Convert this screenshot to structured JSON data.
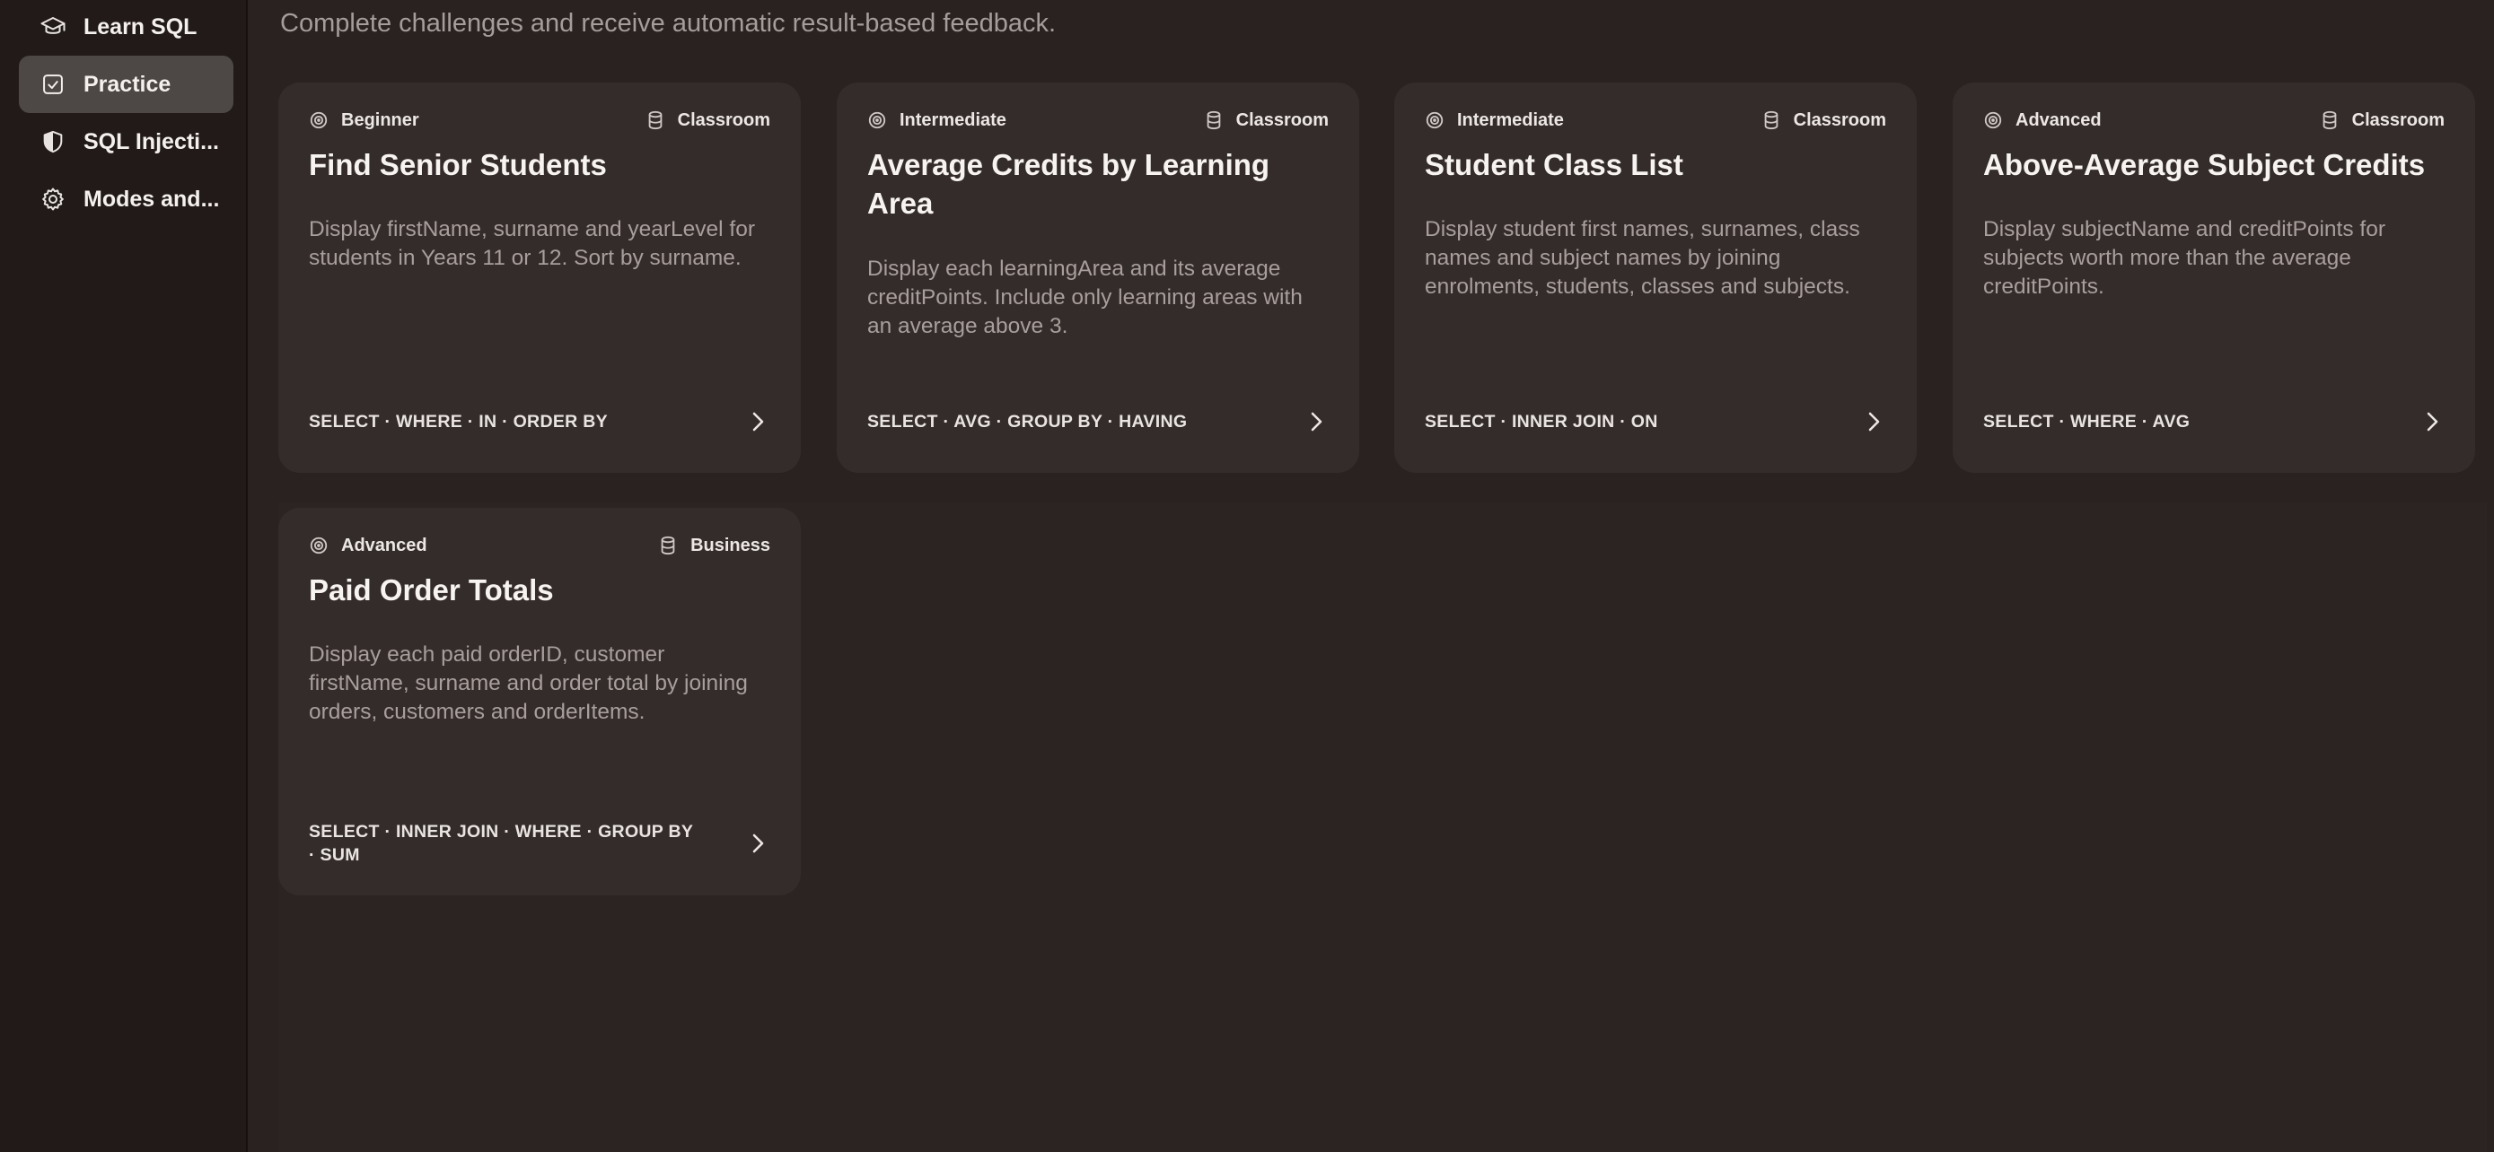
{
  "sidebar": {
    "items": [
      {
        "label": "Learn SQL",
        "icon": "graduation-cap-icon",
        "active": false
      },
      {
        "label": "Practice",
        "icon": "checkbox-icon",
        "active": true
      },
      {
        "label": "SQL Injecti...",
        "icon": "shield-icon",
        "active": false
      },
      {
        "label": "Modes and...",
        "icon": "gear-icon",
        "active": false
      }
    ]
  },
  "main": {
    "subtitle": "Complete challenges and receive automatic result-based feedback."
  },
  "challenges": [
    {
      "level": "Beginner",
      "dataset": "Classroom",
      "title": "Find Senior Students",
      "description": "Display firstName, surname and yearLevel for students in Years 11 or 12. Sort by surname.",
      "keywords": "SELECT · WHERE · IN · ORDER BY"
    },
    {
      "level": "Intermediate",
      "dataset": "Classroom",
      "title": "Average Credits by Learning Area",
      "description": "Display each learningArea and its average creditPoints. Include only learning areas with an average above 3.",
      "keywords": "SELECT · AVG · GROUP BY · HAVING"
    },
    {
      "level": "Intermediate",
      "dataset": "Classroom",
      "title": "Student Class List",
      "description": "Display student first names, surnames, class names and subject names by joining enrolments, students, classes and subjects.",
      "keywords": "SELECT · INNER JOIN · ON"
    },
    {
      "level": "Advanced",
      "dataset": "Classroom",
      "title": "Above-Average Subject Credits",
      "description": "Display subjectName and creditPoints for subjects worth more than the average creditPoints.",
      "keywords": "SELECT · WHERE · AVG"
    },
    {
      "level": "Advanced",
      "dataset": "Business",
      "title": "Paid Order Totals",
      "description": "Display each paid orderID, customer firstName, surname and order total by joining orders, customers and orderItems.",
      "keywords": "SELECT · INNER JOIN · WHERE · GROUP BY · SUM"
    }
  ]
}
